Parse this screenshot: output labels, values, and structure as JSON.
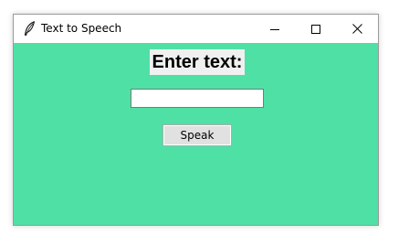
{
  "window": {
    "title": "Text to Speech",
    "app_icon": "feather-icon",
    "controls": {
      "minimize_icon": "minimize-icon",
      "maximize_icon": "maximize-icon",
      "close_icon": "close-icon"
    }
  },
  "content": {
    "background_color": "#4fe0a6",
    "heading": "Enter text:",
    "text_input": {
      "value": "",
      "placeholder": ""
    },
    "speak_button_label": "Speak"
  }
}
